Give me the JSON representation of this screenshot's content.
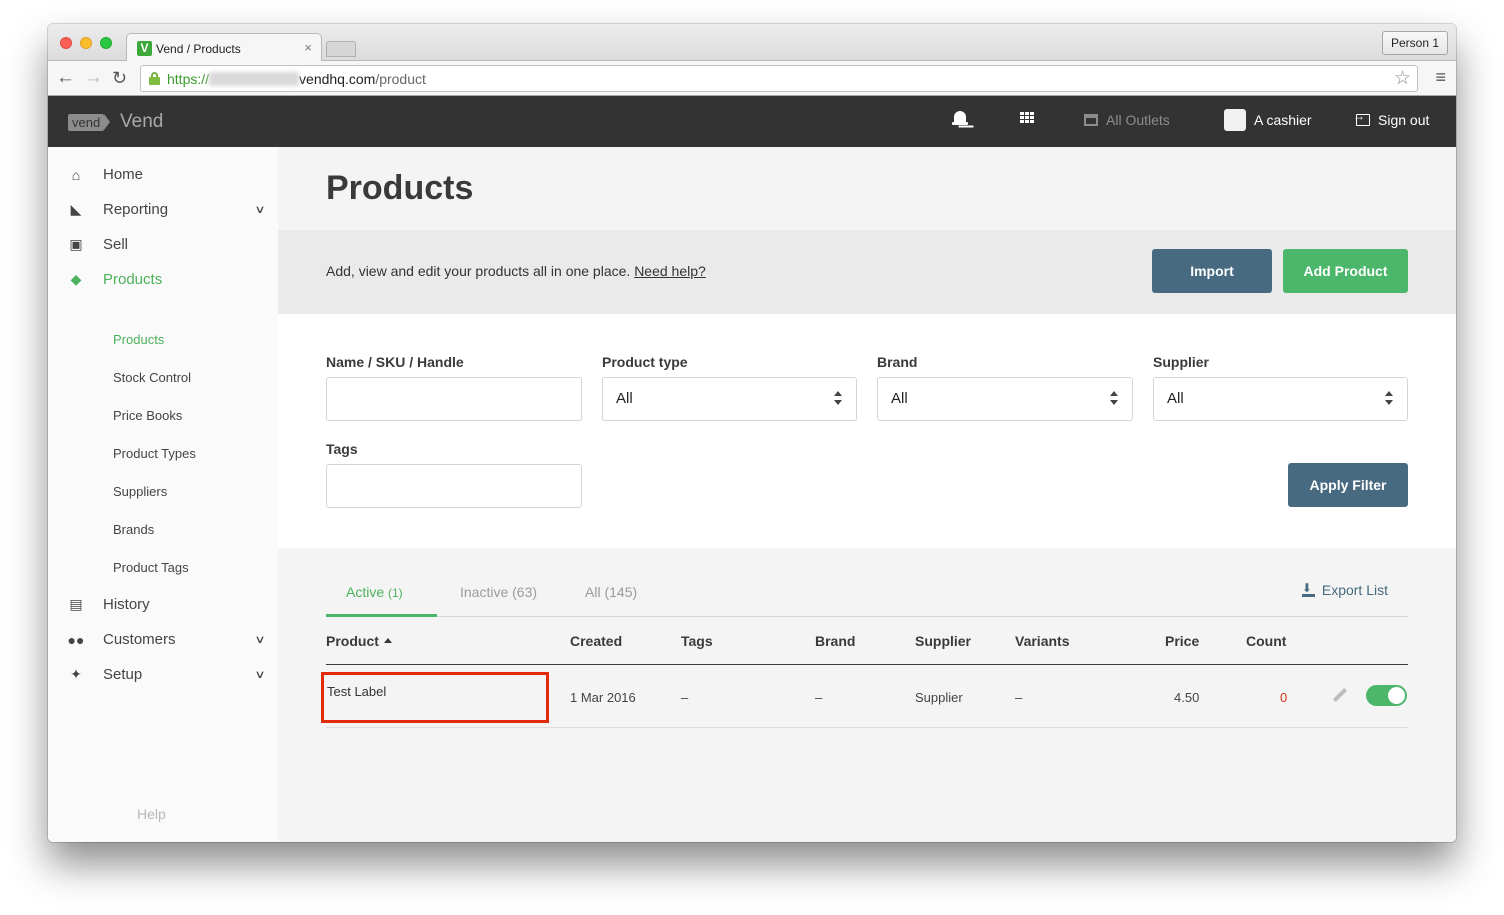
{
  "browser": {
    "tab_title": "Vend / Products",
    "favicon_letter": "V",
    "tab_close": "×",
    "profile": "Person 1",
    "url_scheme": "https://",
    "url_host": "vendhq.com",
    "url_path": "/product",
    "icons": {
      "back": "←",
      "forward": "→",
      "reload": "C",
      "star": "☆",
      "menu": "≡"
    }
  },
  "appbar": {
    "logo": "vend",
    "app_name": "Vend",
    "outlets": "All Outlets",
    "user": "A cashier",
    "signout": "Sign out"
  },
  "sidebar": {
    "items": [
      {
        "label": "Home",
        "icon": "home-icon",
        "glyph": "⌂"
      },
      {
        "label": "Reporting",
        "icon": "chart-area-icon",
        "glyph": "◣",
        "chevron": "⌄"
      },
      {
        "label": "Sell",
        "icon": "cart-icon",
        "glyph": "🛒"
      },
      {
        "label": "Products",
        "icon": "box-icon",
        "glyph": "◆"
      },
      {
        "label": "History",
        "icon": "history-icon",
        "glyph": "▤"
      },
      {
        "label": "Customers",
        "icon": "users-icon",
        "glyph": "👥",
        "chevron": "⌄"
      },
      {
        "label": "Setup",
        "icon": "wrench-icon",
        "glyph": "🔧",
        "chevron": "⌄"
      }
    ],
    "sub_items": [
      "Products",
      "Stock Control",
      "Price Books",
      "Product Types",
      "Suppliers",
      "Brands",
      "Product Tags"
    ],
    "help": "Help"
  },
  "page": {
    "title": "Products",
    "intro": "Add, view and edit your products all in one place.",
    "help_link": "Need help?",
    "import_label": "Import",
    "add_label": "Add Product"
  },
  "filters": {
    "name_label": "Name / SKU / Handle",
    "name_value": "",
    "product_type_label": "Product type",
    "product_type_value": "All",
    "brand_label": "Brand",
    "brand_value": "All",
    "supplier_label": "Supplier",
    "supplier_value": "All",
    "tags_label": "Tags",
    "tags_value": "",
    "apply_label": "Apply Filter"
  },
  "tabs": [
    {
      "label": "Active",
      "count": "(1)",
      "active": true
    },
    {
      "label": "Inactive",
      "count": "(63)"
    },
    {
      "label": "All",
      "count": "(145)"
    }
  ],
  "export_label": "Export List",
  "table": {
    "columns": [
      "Product",
      "Created",
      "Tags",
      "Brand",
      "Supplier",
      "Variants",
      "Price",
      "Count"
    ],
    "rows": [
      {
        "product": "Test Label",
        "created": "1 Mar 2016",
        "tags": "–",
        "brand": "–",
        "supplier": "Supplier",
        "variants": "–",
        "price": "4.50",
        "count": "0",
        "active": true
      }
    ]
  },
  "colors": {
    "accent_green": "#4cb66a",
    "button_blue": "#476a80",
    "appbar": "#333333",
    "highlight_red": "#e12a0a",
    "count_red": "#d0331b"
  }
}
